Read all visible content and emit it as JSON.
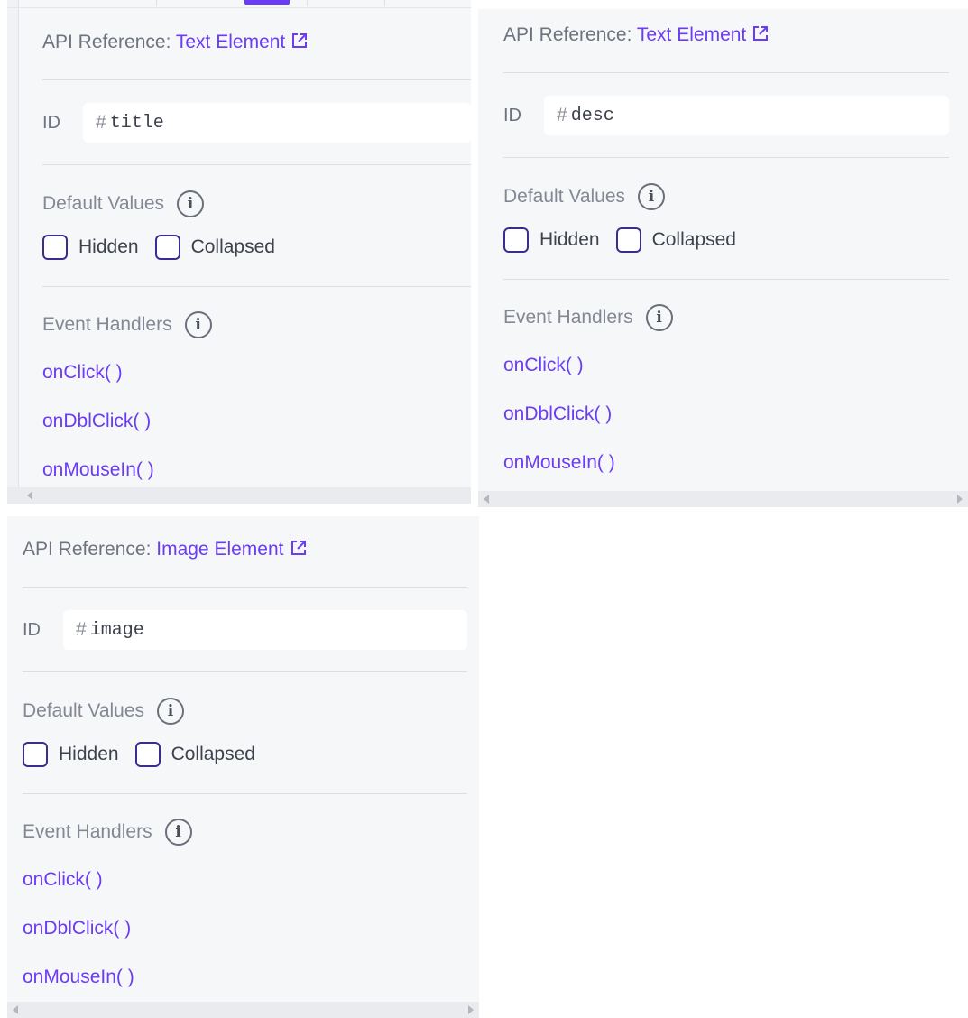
{
  "panels": [
    {
      "api_prefix": "API Reference: ",
      "api_link": "Text Element",
      "id_label": "ID",
      "id_hash": "#",
      "id_value": "title",
      "default_values_label": "Default Values",
      "hidden_label": "Hidden",
      "collapsed_label": "Collapsed",
      "event_handlers_label": "Event Handlers",
      "handlers": [
        "onClick( )",
        "onDblClick( )",
        "onMouseIn( )"
      ]
    },
    {
      "api_prefix": "API Reference: ",
      "api_link": "Text Element",
      "id_label": "ID",
      "id_hash": "#",
      "id_value": "desc",
      "default_values_label": "Default Values",
      "hidden_label": "Hidden",
      "collapsed_label": "Collapsed",
      "event_handlers_label": "Event Handlers",
      "handlers": [
        "onClick( )",
        "onDblClick( )",
        "onMouseIn( )"
      ]
    },
    {
      "api_prefix": "API Reference: ",
      "api_link": "Image Element",
      "id_label": "ID",
      "id_hash": "#",
      "id_value": "image",
      "default_values_label": "Default Values",
      "hidden_label": "Hidden",
      "collapsed_label": "Collapsed",
      "event_handlers_label": "Event Handlers",
      "handlers": [
        "onClick( )",
        "onDblClick( )",
        "onMouseIn( )"
      ]
    }
  ],
  "icons": {
    "external_link": "external-link-icon",
    "info": "info-icon",
    "info_glyph": "i",
    "scroll_left": "scroll-left-arrow-icon",
    "scroll_right": "scroll-right-arrow-icon"
  },
  "colors": {
    "accent": "#6b3cf4",
    "panel_background": "#f6f7f9",
    "checkbox_border": "#3a2d8f"
  }
}
